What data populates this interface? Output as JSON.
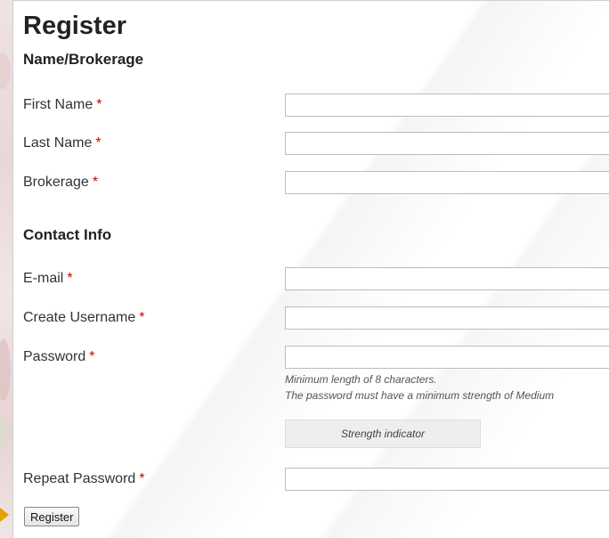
{
  "form": {
    "title": "Register",
    "sections": {
      "name_brokerage": "Name/Brokerage",
      "contact_info": "Contact Info"
    },
    "required_marker": "*",
    "fields": {
      "first_name": {
        "label": "First Name",
        "value": ""
      },
      "last_name": {
        "label": "Last Name",
        "value": ""
      },
      "brokerage": {
        "label": "Brokerage",
        "value": ""
      },
      "email": {
        "label": "E-mail",
        "value": ""
      },
      "username": {
        "label": "Create Username",
        "value": ""
      },
      "password": {
        "label": "Password",
        "value": ""
      },
      "repeat_password": {
        "label": "Repeat Password",
        "value": ""
      }
    },
    "password_hints": {
      "min_length": "Minimum length of 8 characters.",
      "min_strength": "The password must have a minimum strength of Medium"
    },
    "strength_indicator": "Strength indicator",
    "submit_label": "Register"
  },
  "colors": {
    "required": "#d00000",
    "pointer": "#e0a300"
  },
  "icons": {
    "pointer": "arrow-right-icon"
  }
}
